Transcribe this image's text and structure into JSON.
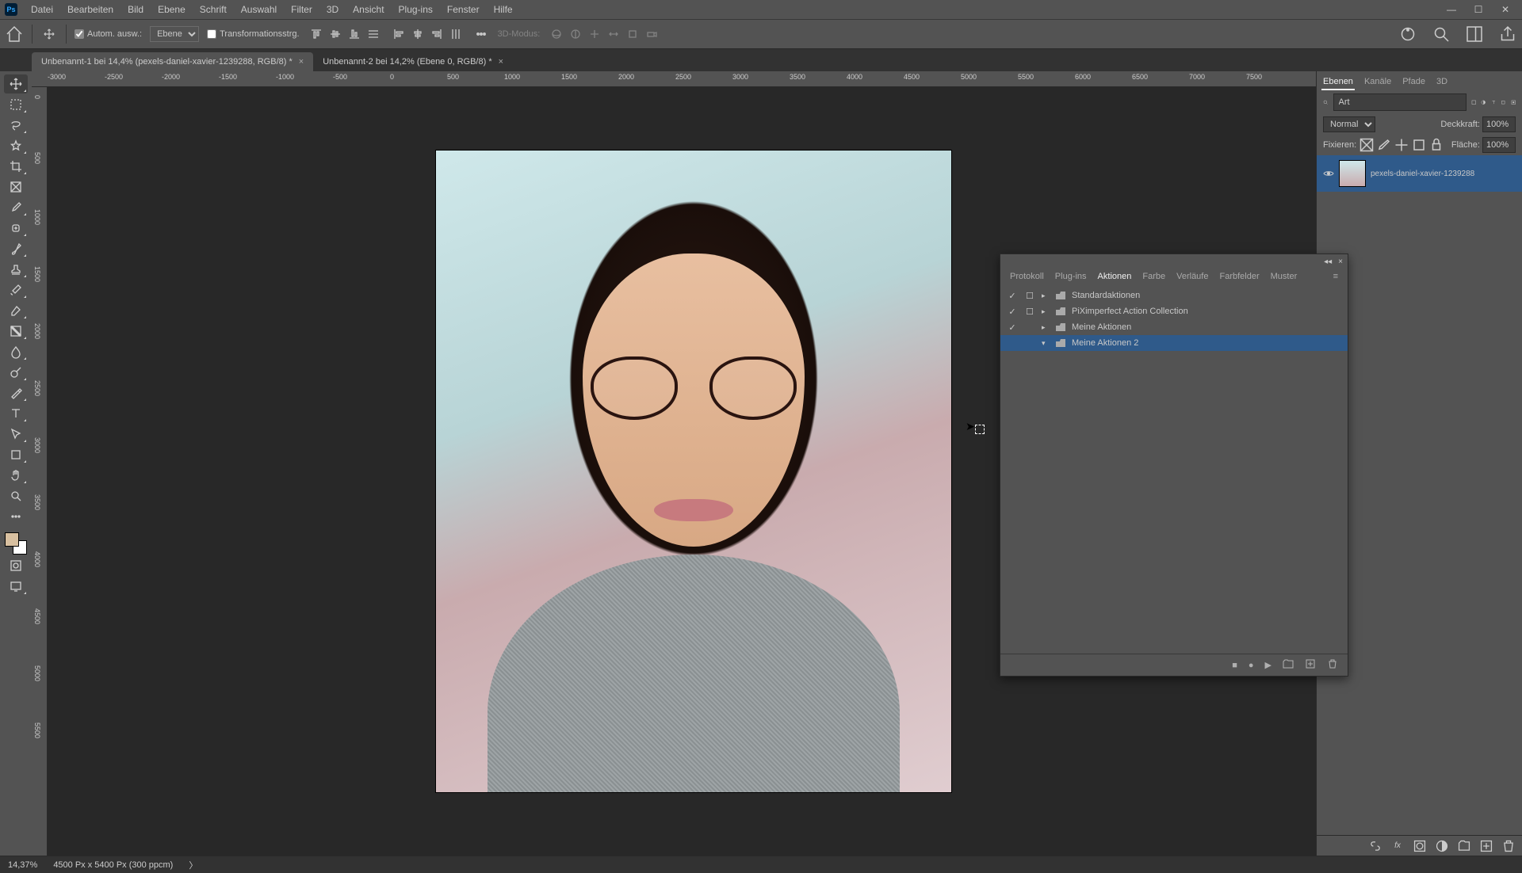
{
  "menubar": {
    "items": [
      "Datei",
      "Bearbeiten",
      "Bild",
      "Ebene",
      "Schrift",
      "Auswahl",
      "Filter",
      "3D",
      "Ansicht",
      "Plug-ins",
      "Fenster",
      "Hilfe"
    ]
  },
  "optionbar": {
    "auto_select_label": "Autom. ausw.:",
    "auto_select_options": [
      "Ebene"
    ],
    "transform_label": "Transformationsstrg.",
    "threeD_label": "3D-Modus:"
  },
  "tabs": [
    {
      "title": "Unbenannt-1 bei 14,4% (pexels-daniel-xavier-1239288, RGB/8) *",
      "active": true
    },
    {
      "title": "Unbenannt-2 bei 14,2% (Ebene 0, RGB/8) *",
      "active": false
    }
  ],
  "ruler_h": [
    "-3000",
    "-2500",
    "-2000",
    "-1500",
    "-1000",
    "-500",
    "0",
    "500",
    "1000",
    "1500",
    "2000",
    "2500",
    "3000",
    "3500",
    "4000",
    "4500",
    "5000",
    "5500",
    "6000",
    "6500",
    "7000",
    "7500"
  ],
  "ruler_v": [
    "0",
    "500",
    "1000",
    "1500",
    "2000",
    "2500",
    "3000",
    "3500",
    "4000",
    "4500",
    "5000",
    "5500"
  ],
  "statusbar": {
    "zoom": "14,37%",
    "docinfo": "4500 Px x 5400 Px (300 ppcm)"
  },
  "layers_panel": {
    "tabs": [
      "Ebenen",
      "Kanäle",
      "Pfade",
      "3D"
    ],
    "search_placeholder": "Art",
    "blend_mode": "Normal",
    "opacity_label": "Deckkraft:",
    "opacity_value": "100%",
    "lock_label": "Fixieren:",
    "fill_label": "Fläche:",
    "fill_value": "100%",
    "layer_name": "pexels-daniel-xavier-1239288"
  },
  "actions_panel": {
    "tabs": [
      "Protokoll",
      "Plug-ins",
      "Aktionen",
      "Farbe",
      "Verläufe",
      "Farbfelder",
      "Muster"
    ],
    "active_tab": "Aktionen",
    "items": [
      {
        "checked": true,
        "dialog": true,
        "expand": "▸",
        "label": "Standardaktionen",
        "selected": false
      },
      {
        "checked": true,
        "dialog": true,
        "expand": "▸",
        "label": "PiXimperfect Action Collection",
        "selected": false
      },
      {
        "checked": true,
        "dialog": false,
        "expand": "▸",
        "label": "Meine Aktionen",
        "selected": false
      },
      {
        "checked": false,
        "dialog": false,
        "expand": "▾",
        "label": "Meine Aktionen 2",
        "selected": true
      }
    ]
  }
}
